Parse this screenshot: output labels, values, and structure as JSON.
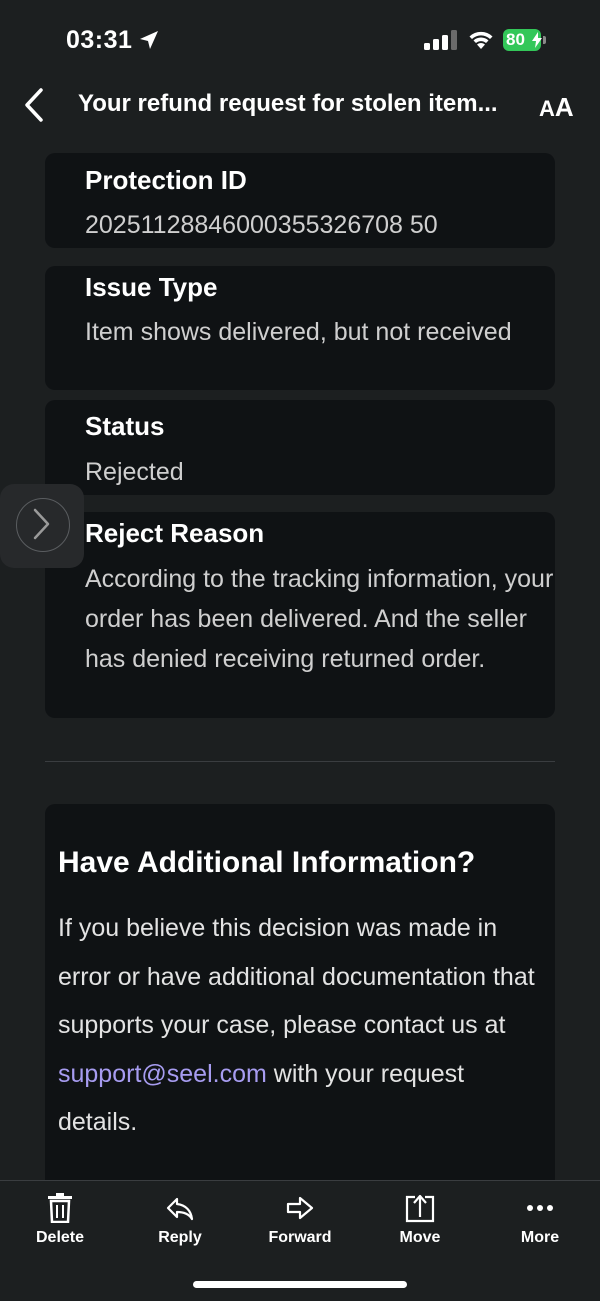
{
  "status_bar": {
    "time": "03:31",
    "battery": "80"
  },
  "header": {
    "title": "Your refund request for stolen item...",
    "text_size_label": "A",
    "text_size_label_big": "A"
  },
  "details": [
    {
      "label": "Protection ID",
      "value": "20251128846000355326708 50"
    },
    {
      "label": "Issue Type",
      "value": "Item shows delivered, but not received"
    },
    {
      "label": "Status",
      "value": "Rejected"
    },
    {
      "label": "Reject Reason",
      "value": "According to the tracking information, your order has been delivered. And the seller has denied receiving returned order."
    }
  ],
  "info": {
    "title": "Have Additional Information?",
    "body_before": "If you believe this decision was made in error or have additional documentation that supports your case, please contact us at ",
    "email": "support@seel.com",
    "body_after": " with your request details."
  },
  "toolbar": {
    "delete": "Delete",
    "reply": "Reply",
    "forward": "Forward",
    "move": "Move",
    "more": "More"
  },
  "colors": {
    "background": "#1c1f20",
    "card": "#0f1214",
    "link": "#a79cf0",
    "battery": "#33c759"
  }
}
